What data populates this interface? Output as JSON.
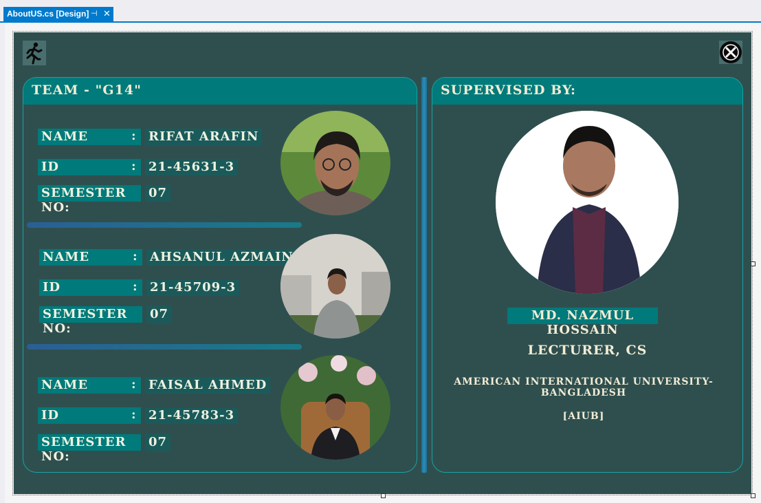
{
  "tab": {
    "title": "AboutUS.cs [Design]",
    "pin_glyph": "⊣",
    "close_glyph": "✕"
  },
  "icons": {
    "run": "running-person-icon",
    "close": "close-circle-icon"
  },
  "team": {
    "header": "TEAM - \"G14\""
  },
  "labels": {
    "name": "NAME",
    "id": "ID",
    "semester": "SEMESTER NO:",
    "colon": ":"
  },
  "members": [
    {
      "name": "RIFAT ARAFIN",
      "id": "21-45631-3",
      "semester": "07"
    },
    {
      "name": "AHSANUL AZMAIN",
      "id": "21-45709-3",
      "semester": "07"
    },
    {
      "name": "FAISAL AHMED",
      "id": "21-45783-3",
      "semester": "07"
    }
  ],
  "supervisor": {
    "header": "SUPERVISED BY:",
    "name": "MD. NAZMUL HOSSAIN",
    "title": "LECTURER, CS",
    "university": "AMERICAN INTERNATIONAL UNIVERSITY-BANGLADESH",
    "abbr": "[AIUB]"
  },
  "colors": {
    "form_bg": "#2f4f4f",
    "accent": "#007a7a",
    "value_bg": "#1b5a5a",
    "divider": "#2b8db8",
    "tab_blue": "#007acc"
  }
}
